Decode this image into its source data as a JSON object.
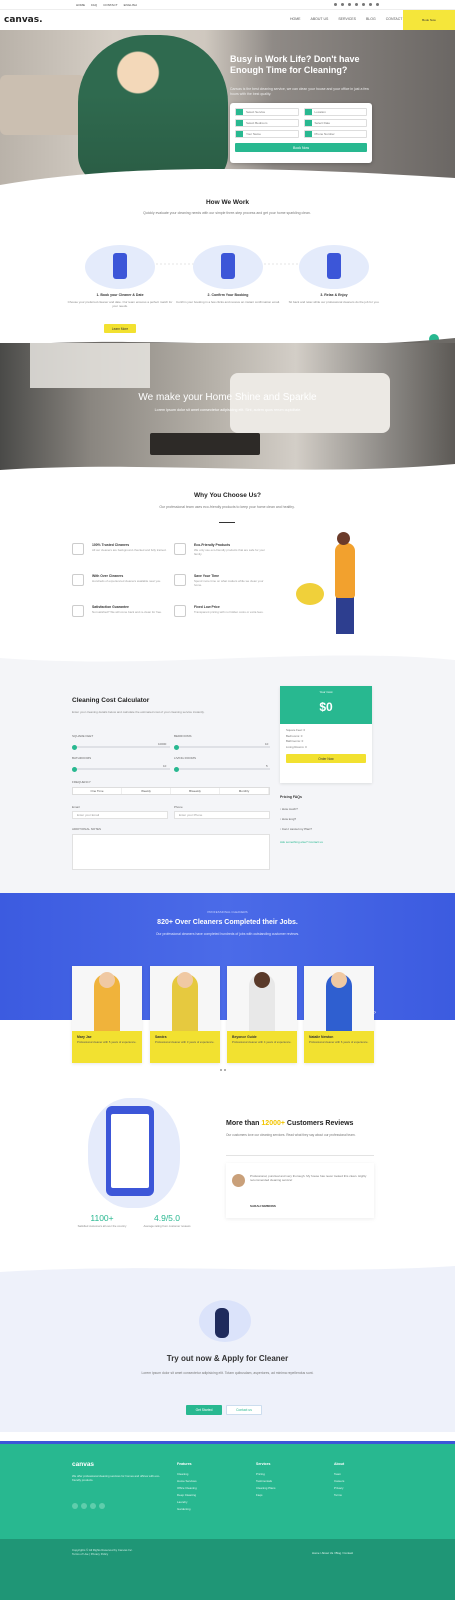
{
  "topbar": {
    "links": [
      "HOME",
      "FAQ",
      "CONTACT",
      "ENGLISH"
    ]
  },
  "header": {
    "logo": "canvas.",
    "nav": [
      "HOME",
      "ABOUT US",
      "SERVICES",
      "BLOG",
      "CONTACT"
    ],
    "cta": "Book Now"
  },
  "hero": {
    "title": "Busy in Work Life? Don't have Enough Time for Cleaning?",
    "subtitle": "Canvas is the best cleaning service, we can clean your house and your office in just a few hours with the best quality.",
    "fields": [
      "Select Service",
      "Location",
      "Select Bedroom",
      "Select Date",
      "Your Name",
      "Phone Number"
    ],
    "button": "Book Now"
  },
  "how": {
    "title": "How We Work",
    "subtitle": "Quickly evaluate your cleaning needs with our simple three-step process and get your home sparkling clean.",
    "steps": [
      {
        "title": "1. Book your Cleaner & Date",
        "desc": "Choose your preferred cleaner and date. Our team ensures a perfect match for your needs."
      },
      {
        "title": "2. Confirm Your Booking",
        "desc": "Confirm your booking in a few clicks and receive an instant confirmation email."
      },
      {
        "title": "3. Relax & Enjoy",
        "desc": "Sit back and relax while our professional cleaners do the job for you."
      }
    ],
    "button": "Learn More"
  },
  "banner": {
    "title": "We make your Home Shine and Sparkle",
    "subtitle": "Lorem ipsum dolor sit amet consectetur adipisicing elit. Sint, autem quos rerum cupiditate."
  },
  "why": {
    "title": "Why You Choose Us?",
    "subtitle": "Our professional team uses eco-friendly products to keep your home clean and healthy.",
    "features": [
      {
        "title": "100% Trusted Cleaners",
        "desc": "All our cleaners are background checked and fully trained."
      },
      {
        "title": "Eco-Friendly Products",
        "desc": "We only use eco-friendly products that are safe for your family."
      },
      {
        "title": "With Over Cleaners",
        "desc": "Hundreds of experienced cleaners available near you."
      },
      {
        "title": "Save Your Time",
        "desc": "Spend more time on what matters while we clean your home."
      },
      {
        "title": "Satisfaction Guarantee",
        "desc": "Not satisfied? We will come back and re-clean for free."
      },
      {
        "title": "Fixed Low Price",
        "desc": "Transparent pricing with no hidden costs or extra fees."
      }
    ]
  },
  "calculator": {
    "title": "Cleaning Cost Calculator",
    "desc": "Enter your cleaning details below and calculate the estimated cost of your cleaning service instantly.",
    "sliders": [
      {
        "label": "SQUARE FEET",
        "max": "10000"
      },
      {
        "label": "BEDROOMS",
        "max": "10"
      },
      {
        "label": "BATHROOMS",
        "max": "10"
      },
      {
        "label": "LIVING ROOMS",
        "max": "5"
      }
    ],
    "frequency_label": "FREQUENCY",
    "frequency": [
      "One Time",
      "Weekly",
      "Biweekly",
      "Monthly"
    ],
    "email_label": "Email",
    "email_placeholder": "Enter your Email",
    "phone_label": "Phone",
    "phone_placeholder": "Enter your Phone",
    "notes_label": "ADDITIONAL NOTES",
    "price_label": "Your Cost",
    "price_value": "$0",
    "price_items": [
      "Square Feet: 0",
      "Bedrooms: 0",
      "Bathrooms: 0",
      "Living Rooms: 0"
    ],
    "order_button": "Order Now",
    "faq_title": "Pricing FAQs",
    "faqs": [
      "How much?",
      "How long?",
      "Can I cancel my Plan?"
    ],
    "faq_more": "Ask something else? Contact us"
  },
  "cleaners": {
    "kicker": "PROFESSIONAL CLEANERS",
    "title": "820+ Over Cleaners Completed their Jobs.",
    "subtitle": "Our professional cleaners have completed hundreds of jobs with outstanding customer reviews.",
    "cards": [
      {
        "name": "Mary Jae",
        "desc": "Professional cleaner with 5 years of experience."
      },
      {
        "name": "Sandra",
        "desc": "Professional cleaner with 3 years of experience."
      },
      {
        "name": "Beyonce Guide",
        "desc": "Professional cleaner with 4 years of experience."
      },
      {
        "name": "Natalie Newton",
        "desc": "Professional cleaner with 6 years of experience."
      }
    ]
  },
  "reviews": {
    "title_prefix": "More than",
    "title_highlight": "12000+",
    "title_suffix": "Customers Reviews",
    "subtitle": "Our customers love our cleaning services. Read what they say about our professional team.",
    "stats": [
      {
        "value": "1100+",
        "label": "Satisfied customers all over the country"
      },
      {
        "value": "4.9/5.0",
        "label": "Average rating from customer reviews"
      }
    ],
    "quote": "Professional, punctual and very thorough. My house has never looked this clean. Highly recommended cleaning service!",
    "author": "SARAH SIMMONS"
  },
  "apply": {
    "title": "Try out now & Apply for Cleaner",
    "subtitle": "Lorem ipsum dolor sit amet consectetur adipisicing elit. Totam quibusdam, asperiores, ad minima repellendus sunt.",
    "primary": "Get Started",
    "secondary": "Contact us"
  },
  "footer": {
    "logo": "canvas",
    "desc": "We offer professional cleaning services for homes and offices with eco-friendly products.",
    "columns": [
      {
        "title": "Features",
        "links": [
          "Cleaning",
          "Home Services",
          "Office Cleaning",
          "Deep Cleaning",
          "Laundry",
          "Gardening"
        ]
      },
      {
        "title": "Services",
        "links": [
          "Pricing",
          "Testimonials",
          "Cleaning Plans",
          "Faqs"
        ]
      },
      {
        "title": "About",
        "links": [
          "Team",
          "Careers",
          "Privacy",
          "Terms"
        ]
      }
    ],
    "copyright": "Copyrights © All Rights Reserved by Canvas Inc.",
    "copyright2": "Terms of Use | Privacy Policy",
    "bottom_links": "Home / About Us / Blog / Contact"
  }
}
